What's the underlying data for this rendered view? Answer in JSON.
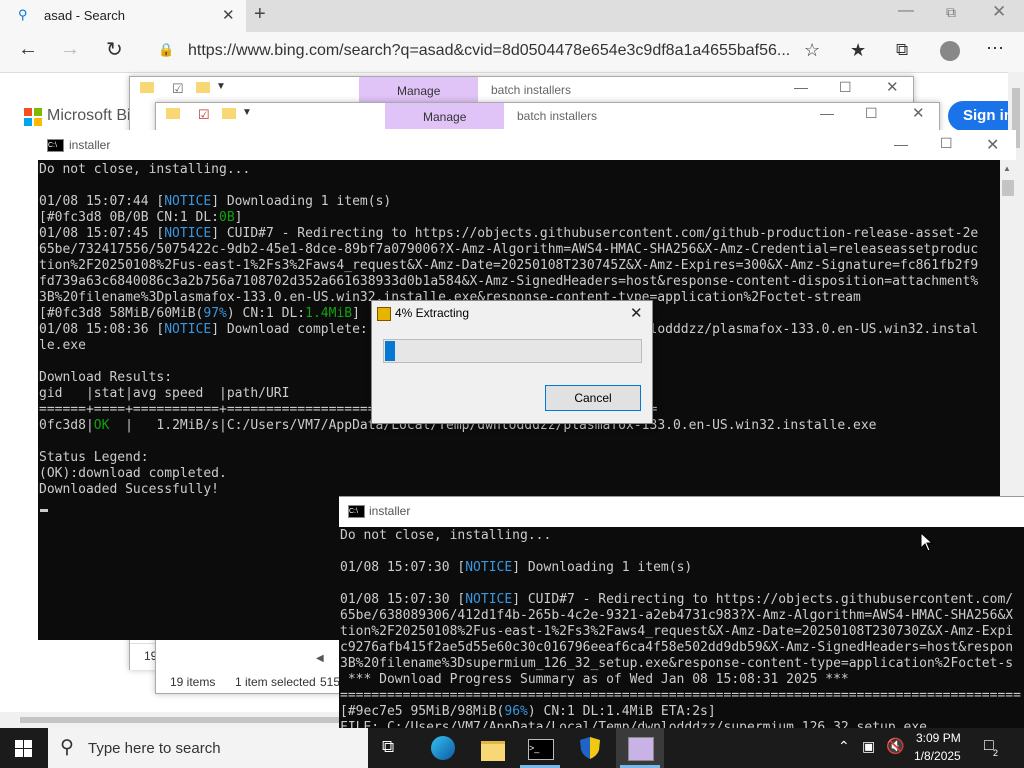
{
  "browser": {
    "tab_title": "asad - Search",
    "address": "https://www.bing.com/search?q=asad&cvid=8d0504478e654e3c9df8a1a4655baf56...",
    "bing_brand": "Microsoft Bin",
    "sign_in": "Sign in"
  },
  "explorer_back": {
    "manage_tab": "Manage",
    "title": "batch installers",
    "items_partial": "19"
  },
  "explorer_front": {
    "manage_tab": "Manage",
    "title": "batch installers",
    "status_items": "19 items",
    "status_selected": "1 item selected",
    "status_size": "515"
  },
  "cmd1": {
    "title": "installer",
    "lines": [
      "Do not close, installing...",
      "",
      "01/08 15:07:44 [NOTICE] Downloading 1 item(s)",
      "[#0fc3d8 0B/0B CN:1 DL:0B]",
      "01/08 15:07:45 [NOTICE] CUID#7 - Redirecting to https://objects.githubusercontent.com/github-production-release-asset-2e",
      "65be/732417556/5075422c-9db2-45e1-8dce-89bf7a079006?X-Amz-Algorithm=AWS4-HMAC-SHA256&X-Amz-Credential=releaseassetproduc",
      "tion%2F20250108%2Fus-east-1%2Fs3%2Faws4_request&X-Amz-Date=20250108T230745Z&X-Amz-Expires=300&X-Amz-Signature=fc861fb2f9",
      "fd739a63c6840086c3a2b756a7108702d352a661638933d0b1a584&X-Amz-SignedHeaders=host&response-content-disposition=attachment%",
      "3B%20filename%3Dplasmafox-133.0.en-US.win32.installe.exe&response-content-type=application%2Foctet-stream",
      "[#0fc3d8 58MiB/60MiB(97%) CN:1 DL:1.4MiB]",
      "01/08 15:08:36 [NOTICE] Download complete: C:/Users/VM7/AppData/Local/Temp/dwnlodddzz/plasmafox-133.0.en-US.win32.instal",
      "le.exe",
      "",
      "Download Results:",
      "gid   |stat|avg speed  |path/URI",
      "======+====+===========+=======================================================",
      "0fc3d8|OK  |   1.2MiB/s|C:/Users/VM7/AppData/Local/Temp/dwnlodddzz/plasmafox-133.0.en-US.win32.installe.exe",
      "",
      "Status Legend:",
      "(OK):download completed.",
      "Downloaded Sucessfully!"
    ]
  },
  "cmd2": {
    "title": "installer",
    "lines": [
      "Do not close, installing...",
      "",
      "01/08 15:07:30 [NOTICE] Downloading 1 item(s)",
      "",
      "01/08 15:07:30 [NOTICE] CUID#7 - Redirecting to https://objects.githubusercontent.com/",
      "65be/638089306/412d1f4b-265b-4c2e-9321-a2eb4731c983?X-Amz-Algorithm=AWS4-HMAC-SHA256&X",
      "tion%2F20250108%2Fus-east-1%2Fs3%2Faws4_request&X-Amz-Date=20250108T230730Z&X-Amz-Expi",
      "c9276afb415f2ae5d55e60c30c016796eeaf6ca4f58e502dd9db59&X-Amz-SignedHeaders=host&respon",
      "3B%20filename%3Dsupermium_126_32_setup.exe&response-content-type=application%2Foctet-s",
      " *** Download Progress Summary as of Wed Jan 08 15:08:31 2025 ***",
      "=======================================================================================",
      "[#9ec7e5 95MiB/98MiB(96%) CN:1 DL:1.4MiB ETA:2s]",
      "FILE: C:/Users/VM7/AppData/Local/Temp/dwnlodddzz/supermium_126_32_setup.exe"
    ]
  },
  "extract_dialog": {
    "title": "4% Extracting",
    "progress": 0.04,
    "cancel": "Cancel"
  },
  "taskbar": {
    "search_placeholder": "Type here to search",
    "time": "3:09 PM",
    "date": "1/8/2025"
  },
  "colors": {
    "accent": "#0078d7",
    "bing_blue": "#1a73e8",
    "manage_bg": "#e0c3f7",
    "cmd_bg": "#0c0c0c",
    "cmd_text": "#cccccc",
    "notice": "#3a96dd",
    "ok": "#13a10e"
  }
}
